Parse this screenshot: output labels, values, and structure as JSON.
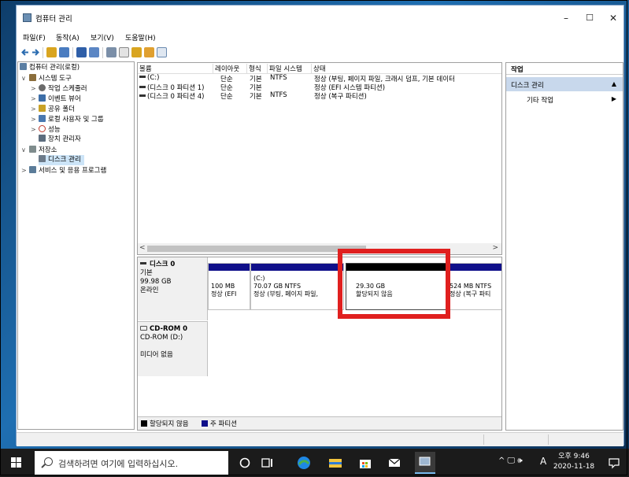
{
  "window": {
    "title": "컴퓨터 관리",
    "minimize": "–",
    "maximize": "☐",
    "close": "✕"
  },
  "menu": [
    "파일(F)",
    "동작(A)",
    "보기(V)",
    "도움말(H)"
  ],
  "tree": [
    {
      "label": "컴퓨터 관리(로컬)",
      "level": 0,
      "expander": "",
      "color": "#5a7ea3"
    },
    {
      "label": "시스템 도구",
      "level": 1,
      "expander": "∨",
      "color": "#8a6d3b"
    },
    {
      "label": "작업 스케줄러",
      "level": 2,
      "expander": ">",
      "color": "#6b6b6b"
    },
    {
      "label": "이벤트 뷰어",
      "level": 2,
      "expander": ">",
      "color": "#3d6ea8"
    },
    {
      "label": "공유 폴더",
      "level": 2,
      "expander": ">",
      "color": "#c9a227"
    },
    {
      "label": "로컬 사용자 및 그룹",
      "level": 2,
      "expander": ">",
      "color": "#4a78b0"
    },
    {
      "label": "성능",
      "level": 2,
      "expander": ">",
      "color": "#c0392b"
    },
    {
      "label": "장치 관리자",
      "level": 2,
      "expander": "",
      "color": "#5d6d7e"
    },
    {
      "label": "저장소",
      "level": 1,
      "expander": "∨",
      "color": "#7f8c8d"
    },
    {
      "label": "디스크 관리",
      "level": 2,
      "expander": "",
      "color": "#6c7a89",
      "selected": true
    },
    {
      "label": "서비스 및 응용 프로그램",
      "level": 1,
      "expander": ">",
      "color": "#5b7c99"
    }
  ],
  "volume_list": {
    "headers": [
      "볼륨",
      "레이아웃",
      "형식",
      "파일 시스템",
      "상태"
    ],
    "rows": [
      [
        "(C:)",
        "단순",
        "기본",
        "NTFS",
        "정상 (부팅, 페이지 파일, 크래시 덤프, 기본 데이터"
      ],
      [
        "(디스크 0 파티션 1)",
        "단순",
        "기본",
        "",
        "정상 (EFI 시스템 파티션)"
      ],
      [
        "(디스크 0 파티션 4)",
        "단순",
        "기본",
        "NTFS",
        "정상 (복구 파티션)"
      ]
    ],
    "scroll_left": "<",
    "scroll_right": ">"
  },
  "disks": [
    {
      "name": "디스크 0",
      "type": "기본",
      "size": "99.98 GB",
      "status": "온라인",
      "partitions": [
        {
          "title": "",
          "line1": "100 MB",
          "line2": "정상 (EFI",
          "kind": "primary"
        },
        {
          "title": "(C:)",
          "line1": "70.07 GB NTFS",
          "line2": "정상 (부팅, 페이지 파일,",
          "kind": "primary"
        },
        {
          "title": "",
          "line1": "29.30 GB",
          "line2": "할당되지 않음",
          "kind": "unallocated"
        },
        {
          "title": "",
          "line1": "524 MB NTFS",
          "line2": "정상 (복구 파티",
          "kind": "primary"
        }
      ]
    },
    {
      "name": "CD-ROM 0",
      "type": "CD-ROM (D:)",
      "size": "",
      "status": "미디어 없음"
    }
  ],
  "legend": [
    {
      "label": "할당되지 않음",
      "color": "#000000"
    },
    {
      "label": "주 파티션",
      "color": "#10108a"
    }
  ],
  "actions": {
    "header": "작업",
    "section": "디스크 관리",
    "section_arrow": "▲",
    "item": "기타 작업",
    "item_arrow": "▶"
  },
  "taskbar": {
    "search_placeholder": "검색하려면 여기에 입력하십시오.",
    "tray_ime": "A",
    "tray_icons": "^ 🖵 🕪",
    "time_period": "오후 9:46",
    "date": "2020-11-18"
  },
  "colors": {
    "primary_partition": "#10108a",
    "unallocated": "#000000",
    "highlight": "#e0201f",
    "selection": "#cce4f7",
    "actions_section": "#c8d8ec"
  }
}
